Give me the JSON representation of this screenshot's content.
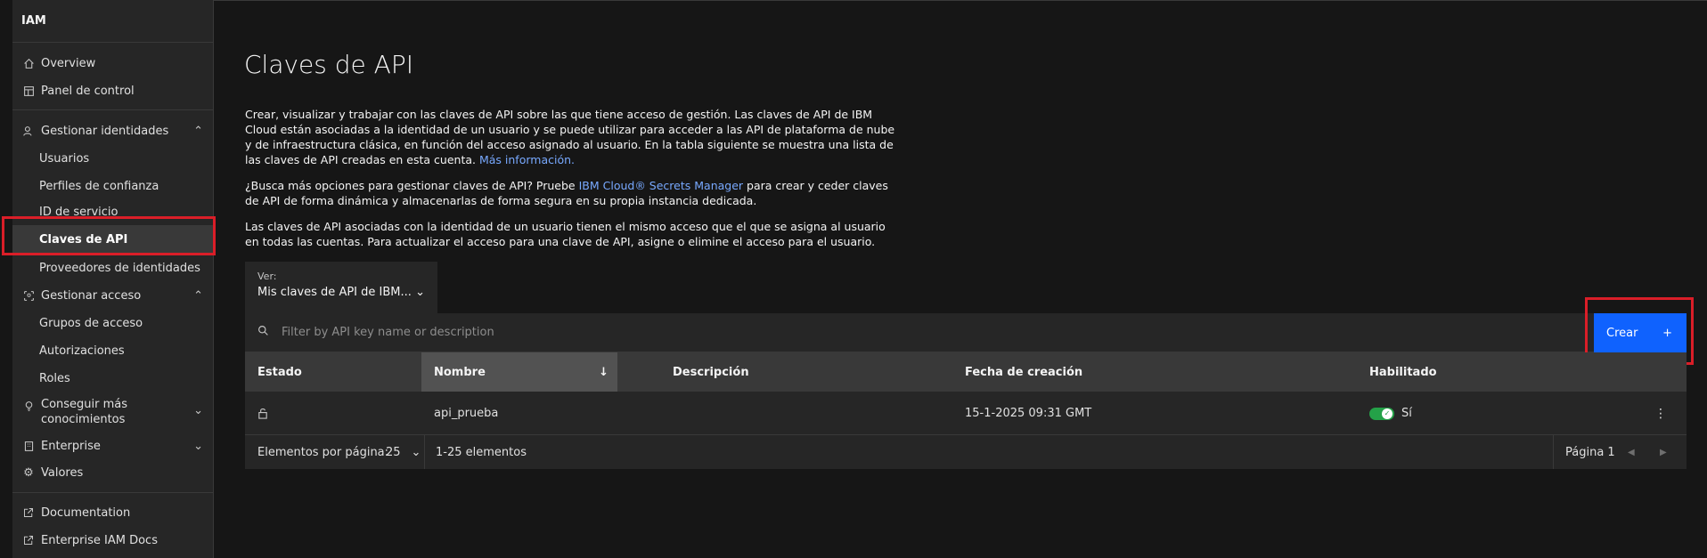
{
  "sidebar": {
    "title": "IAM",
    "items": [
      {
        "label": "Overview",
        "icon": "home-icon"
      },
      {
        "label": "Panel de control",
        "icon": "dashboard-icon"
      },
      {
        "label": "Gestionar identidades",
        "icon": "user-multiple-icon"
      },
      {
        "label": "Usuarios"
      },
      {
        "label": "Perfiles de confianza"
      },
      {
        "label": "ID de servicio"
      },
      {
        "label": "Claves de API"
      },
      {
        "label": "Proveedores de identidades"
      },
      {
        "label": "Gestionar acceso",
        "icon": "access-icon"
      },
      {
        "label": "Grupos de acceso"
      },
      {
        "label": "Autorizaciones"
      },
      {
        "label": "Roles"
      },
      {
        "label": "Conseguir más",
        "label2": "conocimientos",
        "icon": "lightbulb-icon"
      },
      {
        "label": "Enterprise",
        "icon": "building-icon"
      },
      {
        "label": "Valores",
        "icon": "settings-icon"
      },
      {
        "label": "Documentation",
        "icon": "launch-icon"
      },
      {
        "label": "Enterprise IAM Docs",
        "icon": "launch-icon"
      }
    ]
  },
  "main": {
    "title": "Claves de API",
    "p1": "Crear, visualizar y trabajar con las claves de API sobre las que tiene acceso de gestión. Las claves de API de IBM Cloud están asociadas a la identidad de un usuario y se puede utilizar para acceder a las API de plataforma de nube y de infraestructura clásica, en función del acceso asignado al usuario. En la tabla siguiente se muestra una lista de las claves de API creadas en esta cuenta.",
    "p1_link": "Más información.",
    "p2_a": "¿Busca más opciones para gestionar claves de API? Pruebe",
    "p2_link": "IBM Cloud® Secrets Manager",
    "p2_b": "para crear y ceder claves de API de forma dinámica y almacenarlas de forma segura en su propia instancia dedicada.",
    "p3": "Las claves de API asociadas con la identidad de un usuario tienen el mismo acceso que el que se asigna al usuario en todas las cuentas. Para actualizar el acceso para una clave de API, asigne o elimine el acceso para el usuario.",
    "view_label": "Ver:",
    "view_value": "Mis claves de API de IBM...",
    "search_placeholder": "Filter by API key name or description",
    "create_label": "Crear",
    "create_icon": "+"
  },
  "table": {
    "headers": [
      "Estado",
      "Nombre",
      "Descripción",
      "Fecha de creación",
      "Habilitado"
    ],
    "rows": [
      {
        "status_icon": "unlocked-icon",
        "name": "api_prueba",
        "description": "",
        "date": "15-1-2025 09:31 GMT",
        "enabled": "Sí"
      }
    ]
  },
  "pagination": {
    "per_page_label": "Elementos por página:",
    "per_page_value": "25",
    "range": "1-25 elementos",
    "page": "Página 1"
  },
  "colors": {
    "accent": "#0f62fe",
    "highlight": "#da1e28",
    "success": "#24a148"
  }
}
